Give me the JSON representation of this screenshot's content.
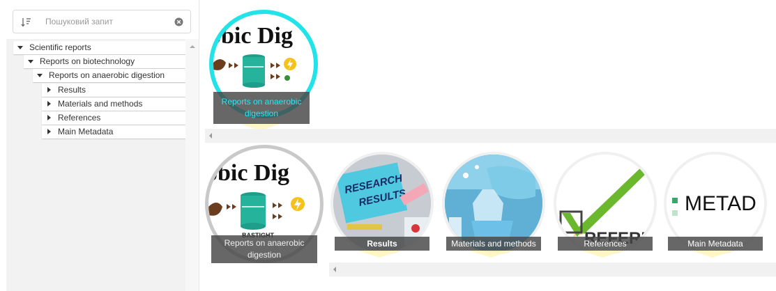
{
  "search": {
    "placeholder": "Пошуковий запит"
  },
  "tree": [
    {
      "label": "Scientific reports",
      "expanded": true,
      "level": 0
    },
    {
      "label": "Reports on biotechnology",
      "expanded": true,
      "level": 1
    },
    {
      "label": "Reports on anaerobic digestion",
      "expanded": true,
      "level": 2
    },
    {
      "label": "Results",
      "expanded": false,
      "level": 3
    },
    {
      "label": "Materials and methods",
      "expanded": false,
      "level": 3
    },
    {
      "label": "References",
      "expanded": false,
      "level": 3
    },
    {
      "label": "Main Metadata",
      "expanded": false,
      "level": 3
    }
  ],
  "selected_card": {
    "label": "Reports on anaerobic digestion",
    "ring_color": "#22e3e8",
    "caption_color": "#2ee6ee",
    "image_text": "obic Dig"
  },
  "cards": [
    {
      "label": "Reports on anaerobic digestion",
      "image_text": "obic Dig",
      "image_text2": "BASTIGHT"
    },
    {
      "label": "Results",
      "image_text": "RESEARCH RESULTS"
    },
    {
      "label": "Materials and methods"
    },
    {
      "label": "References",
      "image_text": "REFERENC"
    },
    {
      "label": "Main Metadata",
      "image_text": "METAD"
    }
  ],
  "colors": {
    "accent": "#22e3e8",
    "caption_bg": "#464646",
    "tail": "#fff6be"
  }
}
